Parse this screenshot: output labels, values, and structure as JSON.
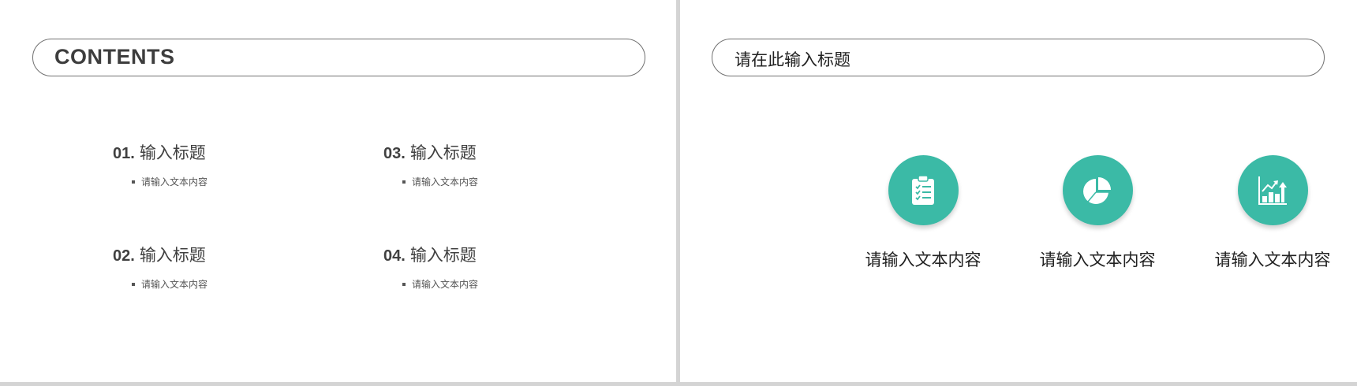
{
  "left_slide": {
    "title": "CONTENTS",
    "items": [
      {
        "number": "01.",
        "title": "输入标题",
        "sub": "请输入文本内容"
      },
      {
        "number": "02.",
        "title": "输入标题",
        "sub": "请输入文本内容"
      },
      {
        "number": "03.",
        "title": "输入标题",
        "sub": "请输入文本内容"
      },
      {
        "number": "04.",
        "title": "输入标题",
        "sub": "请输入文本内容"
      }
    ]
  },
  "right_slide": {
    "title": "请在此输入标题",
    "accent_color": "#3bbaa6",
    "features": [
      {
        "icon": "clipboard-checklist-icon",
        "label": "请输入文本内容"
      },
      {
        "icon": "pie-chart-icon",
        "label": "请输入文本内容"
      },
      {
        "icon": "growth-bar-chart-icon",
        "label": "请输入文本内容"
      }
    ]
  }
}
